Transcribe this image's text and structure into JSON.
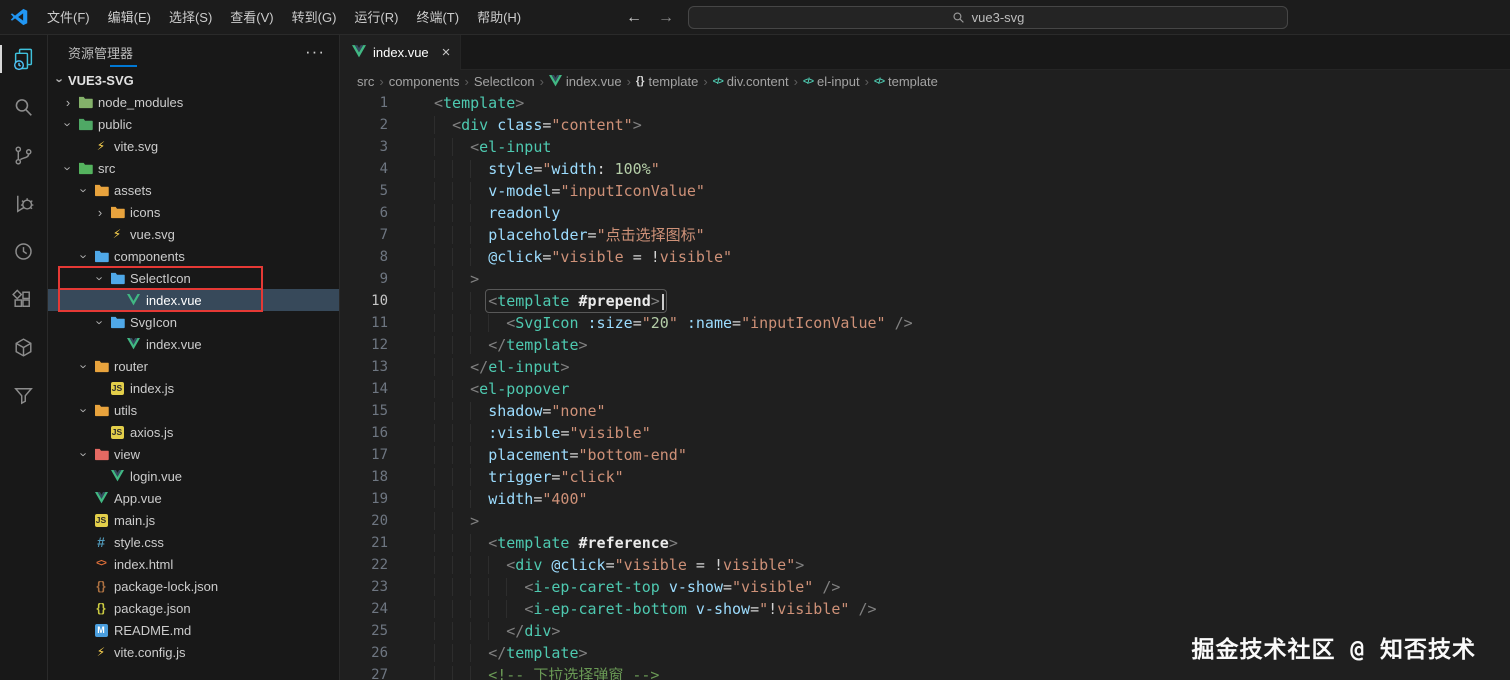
{
  "titlebar": {
    "menus": [
      "文件(F)",
      "编辑(E)",
      "选择(S)",
      "查看(V)",
      "转到(G)",
      "运行(R)",
      "终端(T)",
      "帮助(H)"
    ],
    "back_arrow": "←",
    "forward_arrow": "→",
    "search_value": "vue3-svg"
  },
  "activity_bar": {
    "items": [
      {
        "name": "explorer",
        "active": true
      },
      {
        "name": "search"
      },
      {
        "name": "source-control"
      },
      {
        "name": "run-debug"
      },
      {
        "name": "clock"
      },
      {
        "name": "extensions"
      },
      {
        "name": "container"
      },
      {
        "name": "filter"
      }
    ]
  },
  "sidebar": {
    "title": "资源管理器",
    "more_label": "···",
    "root": "VUE3-SVG",
    "tree": [
      {
        "label": "node_modules",
        "level": 1,
        "kind": "folder",
        "expanded": false,
        "icon": "folder-node"
      },
      {
        "label": "public",
        "level": 1,
        "kind": "folder",
        "expanded": true,
        "icon": "folder-public"
      },
      {
        "label": "vite.svg",
        "level": 2,
        "kind": "file",
        "icon": "vite"
      },
      {
        "label": "src",
        "level": 1,
        "kind": "folder",
        "expanded": true,
        "icon": "folder-src"
      },
      {
        "label": "assets",
        "level": 2,
        "kind": "folder",
        "expanded": true,
        "icon": "folder-assets"
      },
      {
        "label": "icons",
        "level": 3,
        "kind": "folder",
        "expanded": false,
        "icon": "folder-icons"
      },
      {
        "label": "vue.svg",
        "level": 3,
        "kind": "file",
        "icon": "vite"
      },
      {
        "label": "components",
        "level": 2,
        "kind": "folder",
        "expanded": true,
        "icon": "folder-components"
      },
      {
        "label": "SelectIcon",
        "level": 3,
        "kind": "folder",
        "expanded": true,
        "icon": "folder-components",
        "boxed": true
      },
      {
        "label": "index.vue",
        "level": 4,
        "kind": "file",
        "icon": "vue",
        "selected": true,
        "boxed": true
      },
      {
        "label": "SvgIcon",
        "level": 3,
        "kind": "folder",
        "expanded": true,
        "icon": "folder-components"
      },
      {
        "label": "index.vue",
        "level": 4,
        "kind": "file",
        "icon": "vue"
      },
      {
        "label": "router",
        "level": 2,
        "kind": "folder",
        "expanded": true,
        "icon": "folder-router"
      },
      {
        "label": "index.js",
        "level": 3,
        "kind": "file",
        "icon": "js"
      },
      {
        "label": "utils",
        "level": 2,
        "kind": "folder",
        "expanded": true,
        "icon": "folder-utils"
      },
      {
        "label": "axios.js",
        "level": 3,
        "kind": "file",
        "icon": "js"
      },
      {
        "label": "view",
        "level": 2,
        "kind": "folder",
        "expanded": true,
        "icon": "folder-view"
      },
      {
        "label": "login.vue",
        "level": 3,
        "kind": "file",
        "icon": "vue"
      },
      {
        "label": "App.vue",
        "level": 2,
        "kind": "file",
        "icon": "vue"
      },
      {
        "label": "main.js",
        "level": 2,
        "kind": "file",
        "icon": "js"
      },
      {
        "label": "style.css",
        "level": 2,
        "kind": "file",
        "icon": "css"
      },
      {
        "label": "index.html",
        "level": 2,
        "kind": "file",
        "icon": "html"
      },
      {
        "label": "package-lock.json",
        "level": 2,
        "kind": "file",
        "icon": "json-lock"
      },
      {
        "label": "package.json",
        "level": 2,
        "kind": "file",
        "icon": "json"
      },
      {
        "label": "README.md",
        "level": 2,
        "kind": "file",
        "icon": "md"
      },
      {
        "label": "vite.config.js",
        "level": 2,
        "kind": "file",
        "icon": "vite"
      }
    ]
  },
  "editor": {
    "tab": {
      "label": "index.vue",
      "icon": "vue",
      "close": "×"
    },
    "breadcrumb": [
      {
        "label": "src"
      },
      {
        "label": "components"
      },
      {
        "label": "SelectIcon"
      },
      {
        "label": "index.vue",
        "icon": "vue"
      },
      {
        "label": "template",
        "icon": "braces"
      },
      {
        "label": "div.content",
        "icon": "element"
      },
      {
        "label": "el-input",
        "icon": "element"
      },
      {
        "label": "template",
        "icon": "element"
      }
    ],
    "watermark": "掘金技术社区 @ 知否技术",
    "code": [
      {
        "n": 1,
        "ind": 0,
        "tk": [
          [
            "<",
            "g"
          ],
          [
            "template",
            "t"
          ],
          [
            ">",
            "g"
          ]
        ]
      },
      {
        "n": 2,
        "ind": 1,
        "tk": [
          [
            "<",
            "g"
          ],
          [
            "div",
            "t"
          ],
          [
            " ",
            "w"
          ],
          [
            "class",
            "a"
          ],
          [
            "=",
            "w"
          ],
          [
            "\"content\"",
            "s"
          ],
          [
            ">",
            "g"
          ]
        ]
      },
      {
        "n": 3,
        "ind": 2,
        "tk": [
          [
            "<",
            "g"
          ],
          [
            "el-input",
            "t"
          ]
        ]
      },
      {
        "n": 4,
        "ind": 3,
        "tk": [
          [
            "style",
            "a"
          ],
          [
            "=",
            "w"
          ],
          [
            "\"",
            "s"
          ],
          [
            "width",
            "a"
          ],
          [
            ": ",
            "w"
          ],
          [
            "100%",
            "n"
          ],
          [
            "\"",
            "s"
          ]
        ]
      },
      {
        "n": 5,
        "ind": 3,
        "tk": [
          [
            "v-model",
            "a"
          ],
          [
            "=",
            "w"
          ],
          [
            "\"inputIconValue\"",
            "s"
          ]
        ]
      },
      {
        "n": 6,
        "ind": 3,
        "tk": [
          [
            "readonly",
            "a"
          ]
        ]
      },
      {
        "n": 7,
        "ind": 3,
        "tk": [
          [
            "placeholder",
            "a"
          ],
          [
            "=",
            "w"
          ],
          [
            "\"点击选择图标\"",
            "s"
          ]
        ]
      },
      {
        "n": 8,
        "ind": 3,
        "tk": [
          [
            "@click",
            "a"
          ],
          [
            "=",
            "w"
          ],
          [
            "\"visible ",
            "s"
          ],
          [
            "= ",
            "w"
          ],
          [
            "!",
            "w"
          ],
          [
            "visible\"",
            "s"
          ]
        ]
      },
      {
        "n": 9,
        "ind": 2,
        "tk": [
          [
            ">",
            "g"
          ]
        ]
      },
      {
        "n": 10,
        "ind": 3,
        "active": true,
        "tk": [
          [
            "<",
            "g"
          ],
          [
            "template",
            "t"
          ],
          [
            " ",
            "w"
          ],
          [
            "#prepend",
            "h"
          ],
          [
            ">",
            "g"
          ]
        ]
      },
      {
        "n": 11,
        "ind": 4,
        "tk": [
          [
            "<",
            "g"
          ],
          [
            "SvgIcon",
            "t"
          ],
          [
            " ",
            "w"
          ],
          [
            ":size",
            "a"
          ],
          [
            "=",
            "w"
          ],
          [
            "\"",
            "s"
          ],
          [
            "20",
            "n"
          ],
          [
            "\"",
            "s"
          ],
          [
            " ",
            "w"
          ],
          [
            ":name",
            "a"
          ],
          [
            "=",
            "w"
          ],
          [
            "\"inputIconValue\"",
            "s"
          ],
          [
            " />",
            "g"
          ]
        ]
      },
      {
        "n": 12,
        "ind": 3,
        "tk": [
          [
            "</",
            "g"
          ],
          [
            "template",
            "t"
          ],
          [
            ">",
            "g"
          ]
        ]
      },
      {
        "n": 13,
        "ind": 2,
        "tk": [
          [
            "</",
            "g"
          ],
          [
            "el-input",
            "t"
          ],
          [
            ">",
            "g"
          ]
        ]
      },
      {
        "n": 14,
        "ind": 2,
        "tk": [
          [
            "<",
            "g"
          ],
          [
            "el-popover",
            "t"
          ]
        ]
      },
      {
        "n": 15,
        "ind": 3,
        "tk": [
          [
            "shadow",
            "a"
          ],
          [
            "=",
            "w"
          ],
          [
            "\"none\"",
            "s"
          ]
        ]
      },
      {
        "n": 16,
        "ind": 3,
        "tk": [
          [
            ":visible",
            "a"
          ],
          [
            "=",
            "w"
          ],
          [
            "\"visible\"",
            "s"
          ]
        ]
      },
      {
        "n": 17,
        "ind": 3,
        "tk": [
          [
            "placement",
            "a"
          ],
          [
            "=",
            "w"
          ],
          [
            "\"bottom-end\"",
            "s"
          ]
        ]
      },
      {
        "n": 18,
        "ind": 3,
        "tk": [
          [
            "trigger",
            "a"
          ],
          [
            "=",
            "w"
          ],
          [
            "\"click\"",
            "s"
          ]
        ]
      },
      {
        "n": 19,
        "ind": 3,
        "tk": [
          [
            "width",
            "a"
          ],
          [
            "=",
            "w"
          ],
          [
            "\"400\"",
            "s"
          ]
        ]
      },
      {
        "n": 20,
        "ind": 2,
        "tk": [
          [
            ">",
            "g"
          ]
        ]
      },
      {
        "n": 21,
        "ind": 3,
        "tk": [
          [
            "<",
            "g"
          ],
          [
            "template",
            "t"
          ],
          [
            " ",
            "w"
          ],
          [
            "#reference",
            "h"
          ],
          [
            ">",
            "g"
          ]
        ]
      },
      {
        "n": 22,
        "ind": 4,
        "tk": [
          [
            "<",
            "g"
          ],
          [
            "div",
            "t"
          ],
          [
            " ",
            "w"
          ],
          [
            "@click",
            "a"
          ],
          [
            "=",
            "w"
          ],
          [
            "\"visible ",
            "s"
          ],
          [
            "= ",
            "w"
          ],
          [
            "!",
            "w"
          ],
          [
            "visible\"",
            "s"
          ],
          [
            ">",
            "g"
          ]
        ]
      },
      {
        "n": 23,
        "ind": 5,
        "tk": [
          [
            "<",
            "g"
          ],
          [
            "i-ep-caret-top",
            "t"
          ],
          [
            " ",
            "w"
          ],
          [
            "v-show",
            "a"
          ],
          [
            "=",
            "w"
          ],
          [
            "\"visible\"",
            "s"
          ],
          [
            " />",
            "g"
          ]
        ]
      },
      {
        "n": 24,
        "ind": 5,
        "tk": [
          [
            "<",
            "g"
          ],
          [
            "i-ep-caret-bottom",
            "t"
          ],
          [
            " ",
            "w"
          ],
          [
            "v-show",
            "a"
          ],
          [
            "=",
            "w"
          ],
          [
            "\"",
            "s"
          ],
          [
            "!",
            "w"
          ],
          [
            "visible\"",
            "s"
          ],
          [
            " />",
            "g"
          ]
        ]
      },
      {
        "n": 25,
        "ind": 4,
        "tk": [
          [
            "</",
            "g"
          ],
          [
            "div",
            "t"
          ],
          [
            ">",
            "g"
          ]
        ]
      },
      {
        "n": 26,
        "ind": 3,
        "tk": [
          [
            "</",
            "g"
          ],
          [
            "template",
            "t"
          ],
          [
            ">",
            "g"
          ]
        ]
      },
      {
        "n": 27,
        "ind": 3,
        "tk": [
          [
            "<!-- 下拉选择弹窗 -->",
            "c"
          ]
        ]
      }
    ]
  },
  "colors": {
    "accent": "#0078d4",
    "tag": "#4ec9b0",
    "attribute": "#9cdcfe",
    "string": "#ce9178",
    "comment": "#6a9955",
    "annotation_red": "#e53935",
    "selection": "#37495a",
    "vue_green": "#41b883"
  }
}
